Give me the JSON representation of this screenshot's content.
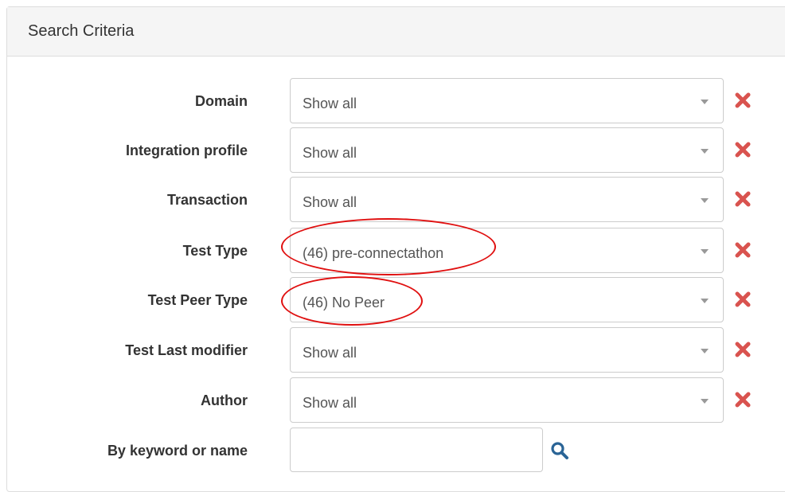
{
  "panel": {
    "title": "Search Criteria"
  },
  "criteria": [
    {
      "label": "Domain",
      "value": "Show all"
    },
    {
      "label": "Integration profile",
      "value": "Show all"
    },
    {
      "label": "Transaction",
      "value": "Show all"
    },
    {
      "label": "Test Type",
      "value": "(46) pre-connectathon"
    },
    {
      "label": "Test Peer Type",
      "value": "(46) No Peer"
    },
    {
      "label": "Test Last modifier",
      "value": "Show all"
    },
    {
      "label": "Author",
      "value": "Show all"
    }
  ],
  "keyword": {
    "label": "By keyword or name",
    "value": "",
    "placeholder": ""
  },
  "icons": {
    "clear": "close-icon",
    "search": "search-icon",
    "dropdown": "caret-down-icon"
  },
  "colors": {
    "clear_icon": "#d9534f",
    "search_icon": "#2a6496",
    "annotation": "#e01010",
    "heading_bg": "#f5f5f5"
  }
}
